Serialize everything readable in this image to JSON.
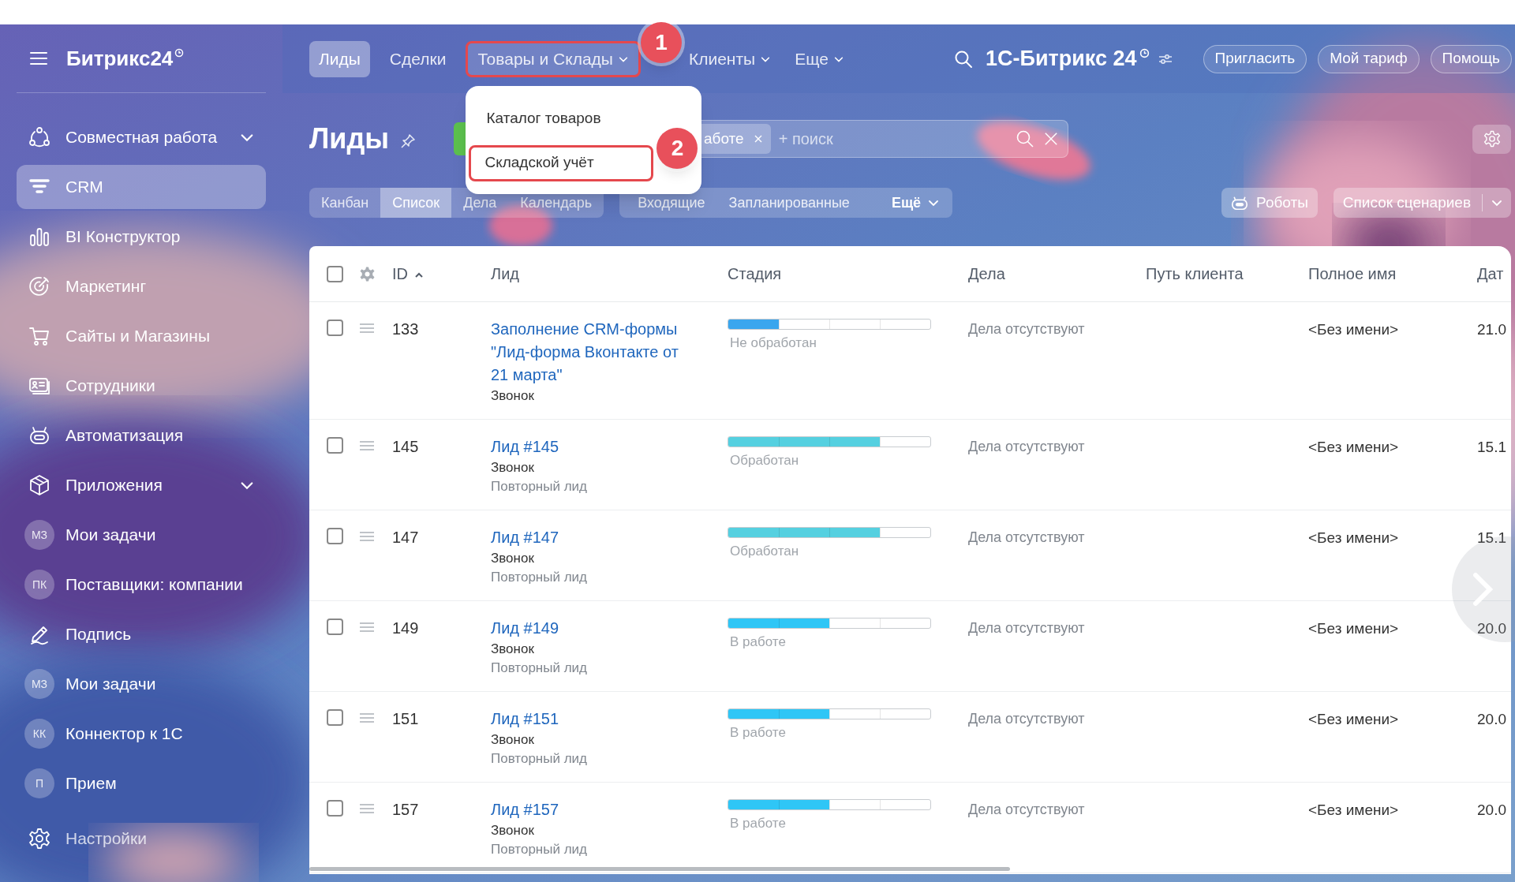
{
  "sidebar": {
    "logo": "Битрикс24",
    "items": [
      {
        "kind": "icon",
        "label": "Совместная работа",
        "expandable": true,
        "selected": false
      },
      {
        "kind": "icon",
        "label": "CRM",
        "expandable": false,
        "selected": true
      },
      {
        "kind": "icon",
        "label": "BI Конструктор",
        "expandable": false,
        "selected": false
      },
      {
        "kind": "icon",
        "label": "Маркетинг",
        "expandable": false,
        "selected": false
      },
      {
        "kind": "icon",
        "label": "Сайты и Магазины",
        "expandable": false,
        "selected": false
      },
      {
        "kind": "icon",
        "label": "Сотрудники",
        "expandable": false,
        "selected": false
      },
      {
        "kind": "icon",
        "label": "Автоматизация",
        "expandable": false,
        "selected": false
      },
      {
        "kind": "icon",
        "label": "Приложения",
        "expandable": true,
        "selected": false
      },
      {
        "kind": "avatar",
        "initials": "МЗ",
        "label": "Мои задачи",
        "expandable": false,
        "selected": false
      },
      {
        "kind": "avatar",
        "initials": "ПК",
        "label": "Поставщики: компании",
        "expandable": false,
        "selected": false
      },
      {
        "kind": "icon",
        "label": "Подпись",
        "expandable": false,
        "selected": false
      },
      {
        "kind": "avatar",
        "initials": "МЗ",
        "label": "Мои задачи",
        "expandable": false,
        "selected": false
      },
      {
        "kind": "avatar",
        "initials": "КК",
        "label": "Коннектор к 1С",
        "expandable": false,
        "selected": false
      },
      {
        "kind": "avatar",
        "initials": "П",
        "label": "Прием",
        "expandable": false,
        "selected": false
      }
    ],
    "settings": "Настройки"
  },
  "top_bar": {
    "tabs": [
      {
        "label": "Лиды",
        "selected": true,
        "dropdown": false
      },
      {
        "label": "Сделки",
        "selected": false,
        "dropdown": false
      },
      {
        "label": "Товары и Склады",
        "selected": false,
        "dropdown": true,
        "callout": "1",
        "menu": [
          {
            "label": "Каталог товаров"
          },
          {
            "label": "Складской учёт",
            "callout": "2"
          }
        ]
      },
      {
        "label": "Клиенты",
        "selected": false,
        "dropdown": true
      },
      {
        "label": "Еще",
        "selected": false,
        "dropdown": true
      }
    ],
    "portal": "1С-Битрикс 24",
    "buttons": [
      "Пригласить",
      "Мой тариф",
      "Помощь"
    ]
  },
  "header": {
    "title": "Лиды",
    "search": {
      "chip": "аботе",
      "placeholder": "+ поиск"
    }
  },
  "filters": {
    "views": [
      {
        "label": "Канбан",
        "selected": false
      },
      {
        "label": "Список",
        "selected": true
      },
      {
        "label": "Дела",
        "selected": false
      },
      {
        "label": "Календарь",
        "selected": false
      }
    ],
    "counters": [
      "Входящие",
      "Запланированные"
    ],
    "more": "Ещё",
    "robots": "Роботы",
    "scenarios": "Список сценариев"
  },
  "table": {
    "header_checked": false,
    "columns": [
      {
        "label": "ID",
        "sorted": true
      },
      {
        "label": "Лид",
        "sorted": false
      },
      {
        "label": "Стадия",
        "sorted": false
      },
      {
        "label": "Дела",
        "sorted": false
      },
      {
        "label": "Путь клиента",
        "sorted": false
      },
      {
        "label": "Полное имя",
        "sorted": false
      },
      {
        "label": "Дат",
        "sorted": false
      }
    ],
    "rows": [
      {
        "checked": false,
        "id": "133",
        "title": "Заполнение CRM-формы \"Лид-форма Вконтакте от 21 марта\"",
        "source": "Звонок",
        "stage": {
          "label": "Не обработан",
          "level": 0.25,
          "color": "#3aa6ee"
        },
        "deals": "Дела отсутствуют",
        "full_name": "<Без имени>",
        "date": "21.0"
      },
      {
        "checked": false,
        "id": "145",
        "title": "Лид #145",
        "source": "Звонок",
        "note": "Повторный лид",
        "stage": {
          "label": "Обработан",
          "level": 0.75,
          "color": "#55d0e0"
        },
        "deals": "Дела отсутствуют",
        "full_name": "<Без имени>",
        "date": "15.1"
      },
      {
        "checked": false,
        "id": "147",
        "title": "Лид #147",
        "source": "Звонок",
        "note": "Повторный лид",
        "stage": {
          "label": "Обработан",
          "level": 0.75,
          "color": "#55d0e0"
        },
        "deals": "Дела отсутствуют",
        "full_name": "<Без имени>",
        "date": "15.1"
      },
      {
        "checked": false,
        "id": "149",
        "title": "Лид #149",
        "source": "Звонок",
        "note": "Повторный лид",
        "stage": {
          "label": "В работе",
          "level": 0.5,
          "color": "#2fc6f6"
        },
        "deals": "Дела отсутствуют",
        "full_name": "<Без имени>",
        "date": "20.0"
      },
      {
        "checked": false,
        "id": "151",
        "title": "Лид #151",
        "source": "Звонок",
        "note": "Повторный лид",
        "stage": {
          "label": "В работе",
          "level": 0.5,
          "color": "#2fc6f6"
        },
        "deals": "Дела отсутствуют",
        "full_name": "<Без имени>",
        "date": "20.0"
      },
      {
        "checked": false,
        "id": "157",
        "title": "Лид #157",
        "source": "Звонок",
        "note": "Повторный лид",
        "stage": {
          "label": "В работе",
          "level": 0.5,
          "color": "#2fc6f6"
        },
        "deals": "Дела отсутствуют",
        "full_name": "<Без имени>",
        "date": "20.0"
      }
    ]
  }
}
